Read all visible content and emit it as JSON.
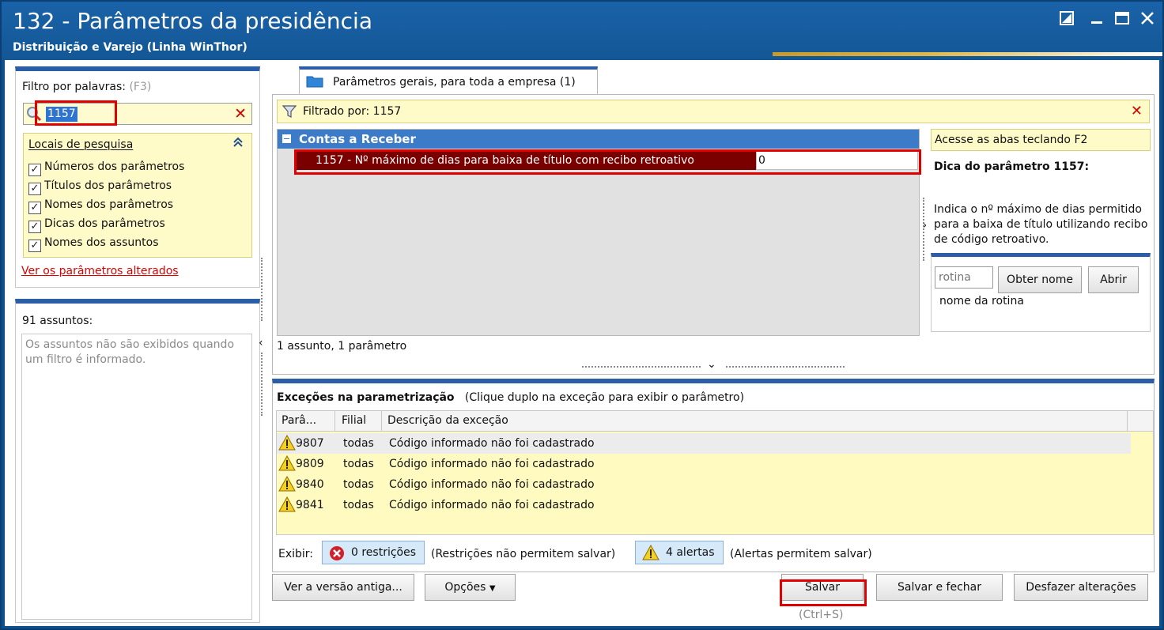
{
  "window": {
    "title": "132 - Parâmetros da presidência",
    "subtitle": "Distribuição e Varejo (Linha WinThor)"
  },
  "sidebar": {
    "filter_label": "Filtro por palavras:",
    "filter_shortcut": "(F3)",
    "search_value": "1157",
    "clear_symbol": "✕",
    "locais_title": "Locais de pesquisa",
    "checkboxes": [
      {
        "label": "Números dos parâmetros",
        "checked": true
      },
      {
        "label": "Títulos dos parâmetros",
        "checked": true
      },
      {
        "label": "Nomes dos parâmetros",
        "checked": true
      },
      {
        "label": "Dicas dos parâmetros",
        "checked": true
      },
      {
        "label": "Nomes dos assuntos",
        "checked": true
      }
    ],
    "changed_link": "Ver os parâmetros alterados",
    "assuntos_count": "91 assuntos:",
    "assuntos_empty": "Os assuntos não são exibidos quando um filtro é informado."
  },
  "main": {
    "tab_label": "Parâmetros gerais, para toda a empresa  (1)",
    "filtered_text": "Filtrado por: 1157",
    "group_label": "Contas a Receber",
    "param_name": "1157 - Nº máximo de dias para baixa de título com recibo retroativo",
    "param_value": "0",
    "status": "1 assunto, 1 parâmetro",
    "side_hint": "Acesse as abas teclando F2",
    "dica_title": "Dica do parâmetro 1157:",
    "dica_text": "Indica o nº máximo de dias permitido para a baixa de título utilizando recibo de código retroativo.",
    "rotina_placeholder": "rotina",
    "btn_obter": "Obter nome",
    "btn_abrir": "Abrir",
    "rotina_hint": "nome da rotina"
  },
  "exceptions": {
    "title": "Exceções na parametrização",
    "subtitle": "(Clique duplo na exceção para exibir o parâmetro)",
    "columns": [
      "Parâ...",
      "Filial",
      "Descrição da exceção"
    ],
    "rows": [
      {
        "param": "9807",
        "filial": "todas",
        "desc": "Código informado não foi cadastrado"
      },
      {
        "param": "9809",
        "filial": "todas",
        "desc": "Código informado não foi cadastrado"
      },
      {
        "param": "9840",
        "filial": "todas",
        "desc": "Código informado não foi cadastrado"
      },
      {
        "param": "9841",
        "filial": "todas",
        "desc": "Código informado não foi cadastrado"
      }
    ],
    "exibir_label": "Exibir:",
    "restricoes": "0 restrições",
    "restricoes_note": "(Restrições não permitem salvar)",
    "alertas": "4 alertas",
    "alertas_note": "(Alertas permitem salvar)"
  },
  "footer": {
    "versao_antiga": "Ver a versão antiga...",
    "opcoes": "Opções",
    "salvar": "Salvar",
    "salvar_shortcut": "(Ctrl+S)",
    "salvar_fechar": "Salvar e fechar",
    "desfazer": "Desfazer alterações"
  },
  "colors": {
    "accent": "#2c5ea8",
    "highlight": "#e00000",
    "selected_row": "#7a0000"
  }
}
